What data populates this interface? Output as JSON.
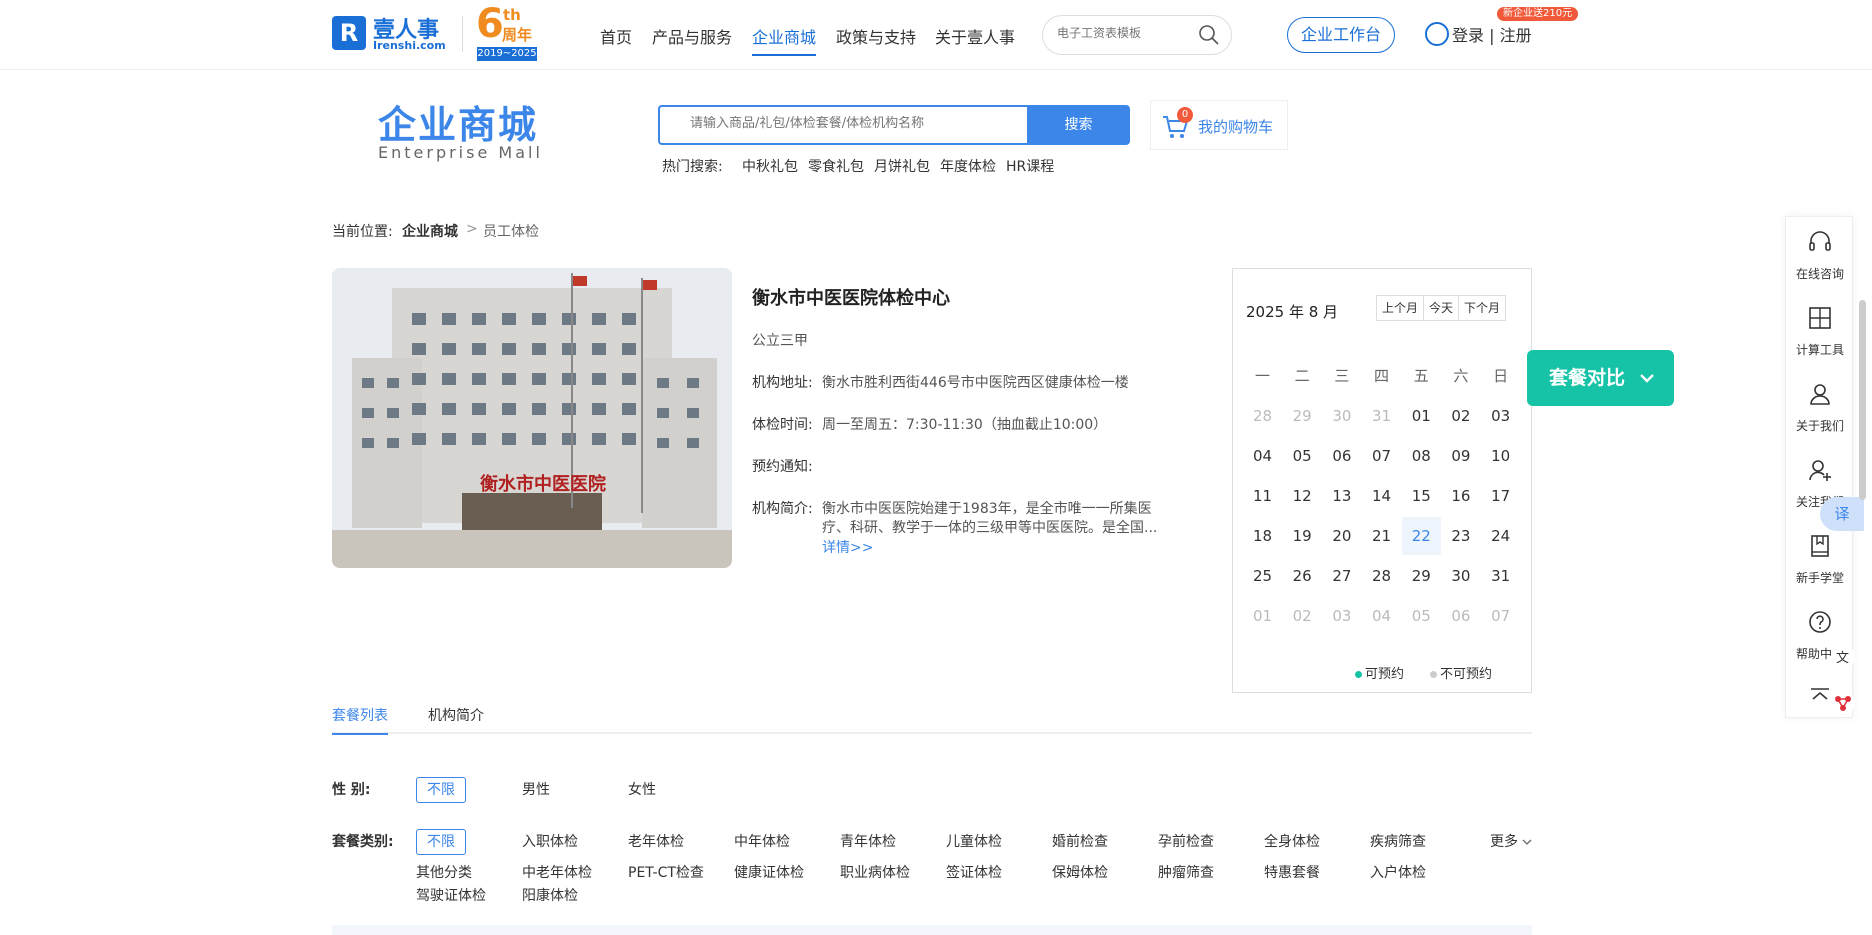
{
  "topnav": {
    "logo_mark": "R",
    "logo_name": "壹人事",
    "logo_domain": "Irenshi.com",
    "anniversary_num": "6",
    "anniversary_th": "th",
    "anniversary_zh": "周年",
    "anniversary_years": "2019~2025",
    "items": [
      "首页",
      "产品与服务",
      "企业商城",
      "政策与支持",
      "关于壹人事"
    ],
    "active_index": 2,
    "search_placeholder": "电子工资表模板",
    "workbench": "企业工作台",
    "login": "登录 | 注册",
    "promo": "新企业送210元"
  },
  "mall": {
    "title": "企业商城",
    "subtitle": "Enterprise  Mall",
    "search_placeholder": "请输入商品/礼包/体检套餐/体检机构名称",
    "search_button": "搜索",
    "cart_count": "0",
    "cart_label": "我的购物车",
    "hot_label": "热门搜索:",
    "hot_terms": [
      "中秋礼包",
      "零食礼包",
      "月饼礼包",
      "年度体检",
      "HR课程"
    ]
  },
  "breadcrumb": {
    "prefix": "当前位置:",
    "level1": "企业商城",
    "separator": ">",
    "level2": "员工体检"
  },
  "institution": {
    "name": "衡水市中医医院体检中心",
    "grade": "公立三甲",
    "address_label": "机构地址:",
    "address": "衡水市胜利西街446号市中医院西区健康体检一楼",
    "hours_label": "体检时间:",
    "hours": "周一至周五：7:30-11:30（抽血截止10:00）",
    "notice_label": "预约通知:",
    "intro_label": "机构简介:",
    "intro_line1": "衡水市中医医院始建于1983年，是全市唯一一所集医",
    "intro_line2": "疗、科研、教学于一体的三级甲等中医医院。是全国...",
    "detail_link": "详情>>",
    "photo_sign": "衡水市中医医院"
  },
  "calendar": {
    "title": "2025 年 8 月",
    "prev": "上个月",
    "today": "今天",
    "next": "下个月",
    "weekdays": [
      "一",
      "二",
      "三",
      "四",
      "五",
      "六",
      "日"
    ],
    "weeks": [
      [
        "28",
        "29",
        "30",
        "31",
        "01",
        "02",
        "03"
      ],
      [
        "04",
        "05",
        "06",
        "07",
        "08",
        "09",
        "10"
      ],
      [
        "11",
        "12",
        "13",
        "14",
        "15",
        "16",
        "17"
      ],
      [
        "18",
        "19",
        "20",
        "21",
        "22",
        "23",
        "24"
      ],
      [
        "25",
        "26",
        "27",
        "28",
        "29",
        "30",
        "31"
      ],
      [
        "01",
        "02",
        "03",
        "04",
        "05",
        "06",
        "07"
      ]
    ],
    "muted": [
      [
        0,
        0
      ],
      [
        0,
        1
      ],
      [
        0,
        2
      ],
      [
        0,
        3
      ],
      [
        5,
        0
      ],
      [
        5,
        1
      ],
      [
        5,
        2
      ],
      [
        5,
        3
      ],
      [
        5,
        4
      ],
      [
        5,
        5
      ],
      [
        5,
        6
      ]
    ],
    "today_cell": [
      3,
      4
    ],
    "legend_available": "可预约",
    "legend_unavailable": "不可预约",
    "available_color": "#17c3a6",
    "unavailable_color": "#cccccc"
  },
  "compare_button": "套餐对比",
  "tabs": [
    "套餐列表",
    "机构简介"
  ],
  "filters": {
    "gender_label": "性      别:",
    "gender_options": [
      "不限",
      "男性",
      "女性"
    ],
    "category_label": "套餐类别:",
    "category_row1": [
      "不限",
      "入职体检",
      "老年体检",
      "中年体检",
      "青年体检",
      "儿童体检",
      "婚前检查",
      "孕前检查",
      "全身体检",
      "疾病筛查"
    ],
    "category_row2": [
      "其他分类",
      "中老年体检",
      "PET-CT检查",
      "健康证体检",
      "职业病体检",
      "签证体检",
      "保姆体检",
      "肿瘤筛查",
      "特惠套餐",
      "入户体检"
    ],
    "category_row3": [
      "驾驶证体检",
      "阳康体检"
    ],
    "more": "更多"
  },
  "sidebar": {
    "items": [
      "在线咨询",
      "计算工具",
      "关于我们",
      "关注我们",
      "新手学堂",
      "帮助中心"
    ],
    "translate": "译"
  },
  "colors": {
    "brand": "#1a6fd6",
    "accent": "#3b86e8",
    "teal": "#17c3a6",
    "orange": "#f08c1f"
  }
}
